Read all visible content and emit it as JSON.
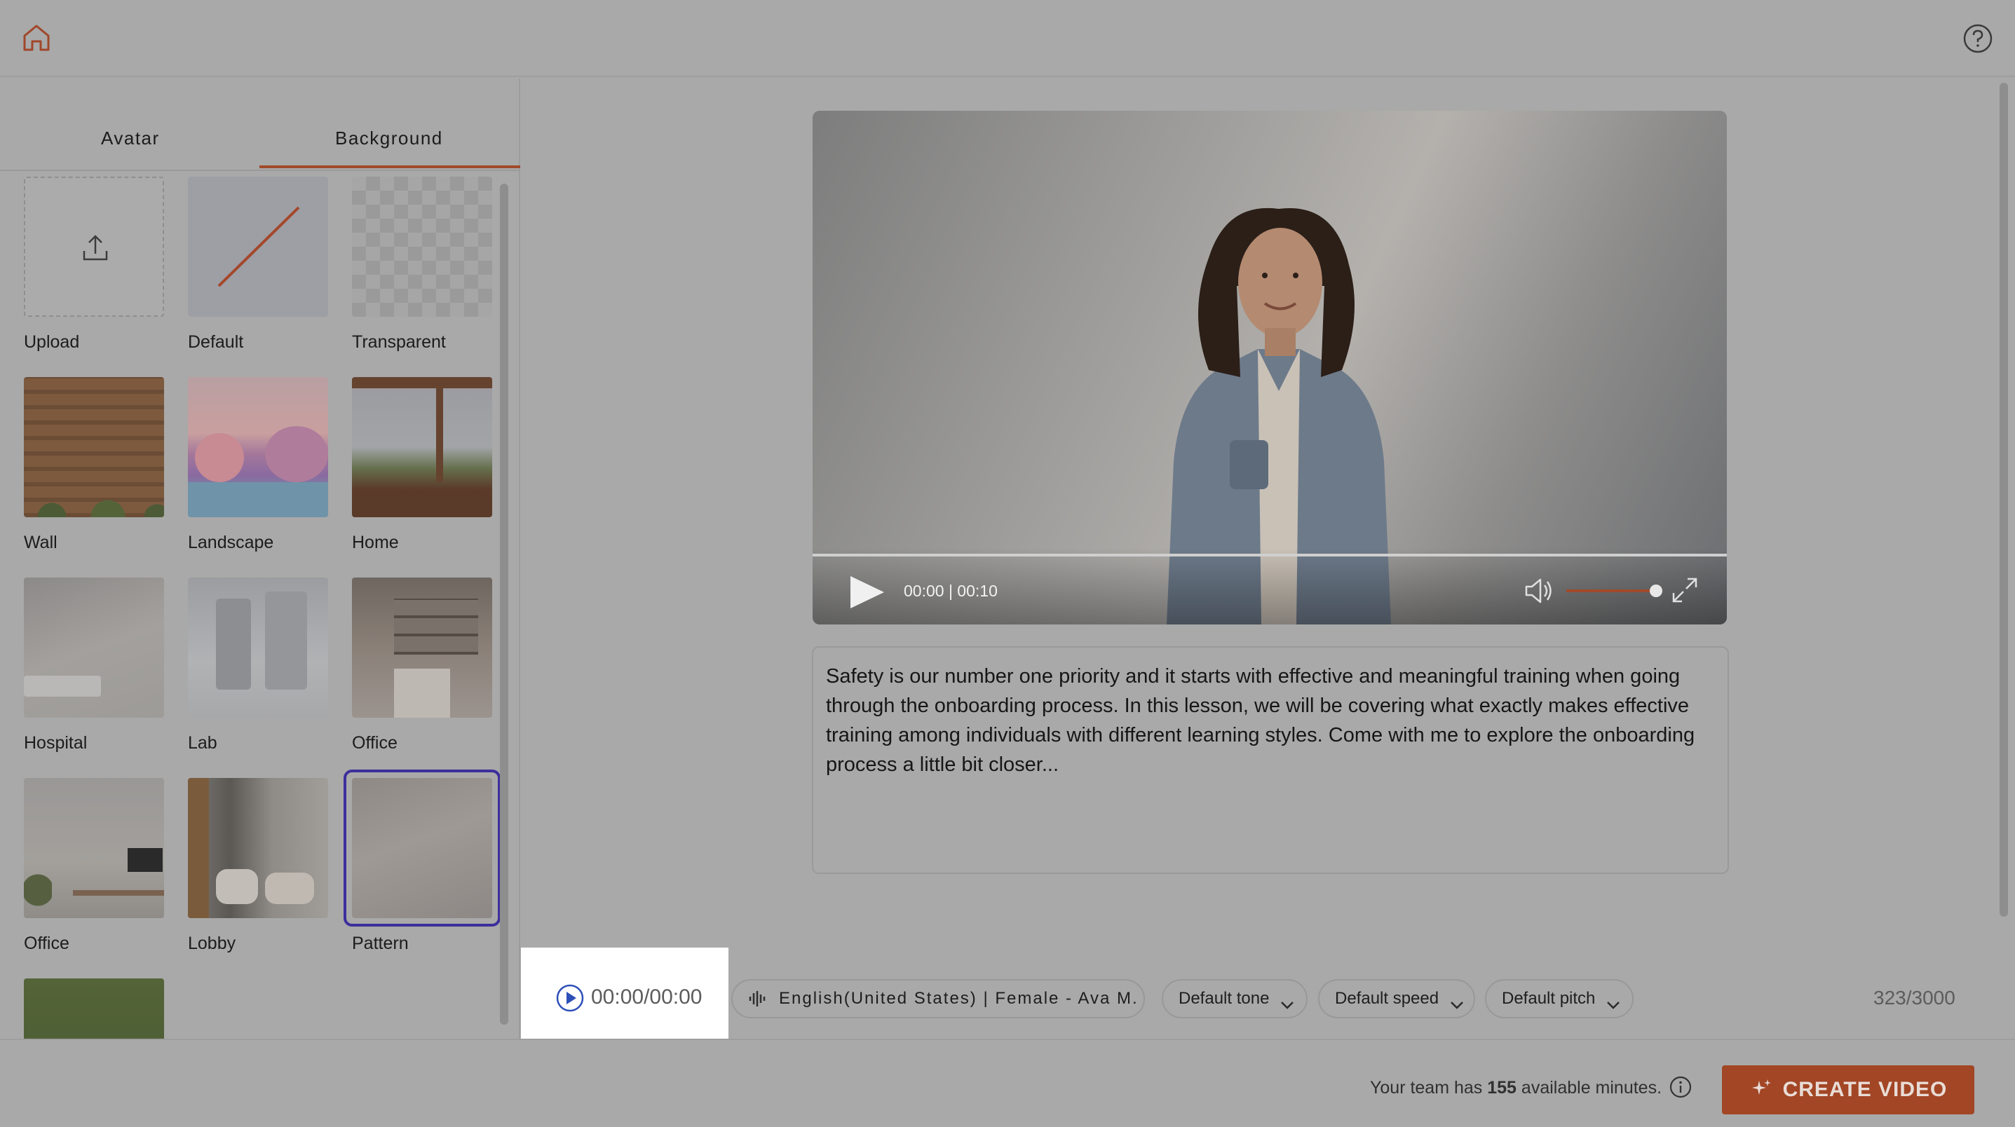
{
  "header": {
    "home_icon": "home-icon",
    "help_icon": "help-circle-icon"
  },
  "tabs": [
    {
      "label": "Avatar"
    },
    {
      "label": "Background",
      "active": true
    }
  ],
  "backgrounds": [
    {
      "label": "Upload"
    },
    {
      "label": "Default"
    },
    {
      "label": "Transparent"
    },
    {
      "label": "Wall"
    },
    {
      "label": "Landscape"
    },
    {
      "label": "Home"
    },
    {
      "label": "Hospital"
    },
    {
      "label": "Lab"
    },
    {
      "label": "Office"
    },
    {
      "label": "Office"
    },
    {
      "label": "Lobby"
    },
    {
      "label": "Pattern",
      "selected": true
    }
  ],
  "video": {
    "time": "00:00 | 00:10",
    "volume": 0.88,
    "progress": 0
  },
  "script": {
    "text": "Safety is our number one priority and it starts with effective and meaningful training when going through the onboarding process. In this lesson, we will be covering what exactly makes effective training among individuals with different learning styles. Come with me to explore the onboarding process a little bit closer..."
  },
  "toolbar": {
    "preview_time": "00:00/00:00",
    "voice": "English(United States) | Female - Ava M.",
    "tone": "Default tone",
    "speed": "Default speed",
    "pitch": "Default pitch",
    "char_count": "323/3000"
  },
  "footer": {
    "minutes_prefix": "Your team has",
    "minutes_value": "155",
    "minutes_suffix": "available minutes.",
    "create_label": "CREATE VIDEO"
  },
  "colors": {
    "accent": "#a24625",
    "selected_ring": "#3d2f9c",
    "background": "#a9a9a9"
  }
}
